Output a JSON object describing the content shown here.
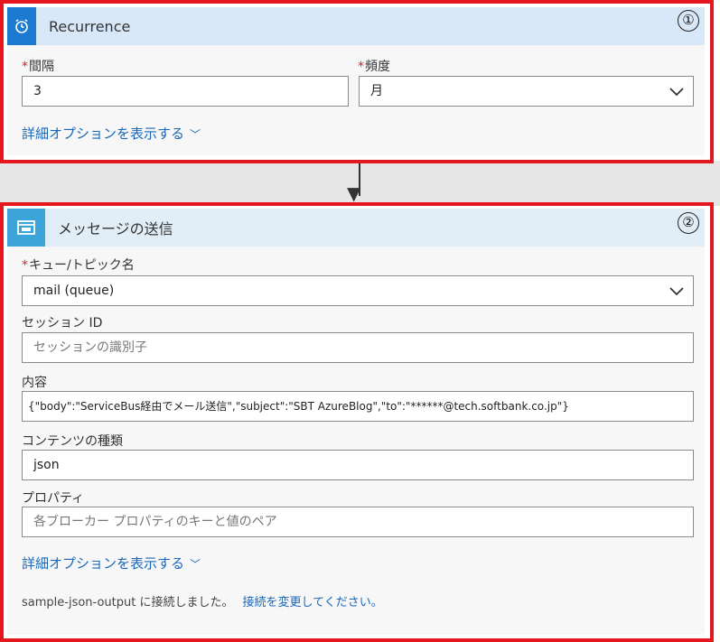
{
  "card1": {
    "title": "Recurrence",
    "badge": "①",
    "interval": {
      "label": "間隔",
      "value": "3"
    },
    "frequency": {
      "label": "頻度",
      "value": "月"
    },
    "advanced_link": "詳細オプションを表示する"
  },
  "card2": {
    "title": "メッセージの送信",
    "badge": "②",
    "queue": {
      "label": "キュー/トピック名",
      "value": "mail (queue)"
    },
    "session": {
      "label": "セッション ID",
      "placeholder": "セッションの識別子"
    },
    "content": {
      "label": "内容",
      "value": "{\"body\":\"ServiceBus経由でメール送信\",\"subject\":\"SBT AzureBlog\",\"to\":\"******@tech.softbank.co.jp\"}"
    },
    "content_type": {
      "label": "コンテンツの種類",
      "value": "json"
    },
    "properties": {
      "label": "プロパティ",
      "placeholder": "各ブローカー プロパティのキーと値のペア"
    },
    "advanced_link": "詳細オプションを表示する",
    "connection_text": "sample-json-output に接続しました。",
    "change_connection": "接続を変更してください。"
  },
  "colors": {
    "highlight_frame": "#e5161d",
    "link": "#1a67b8",
    "required": "#d1252e"
  },
  "icons": {
    "card1": "alarm-clock-icon",
    "card2": "service-bus-icon",
    "dropdown": "chevron-down-icon"
  }
}
